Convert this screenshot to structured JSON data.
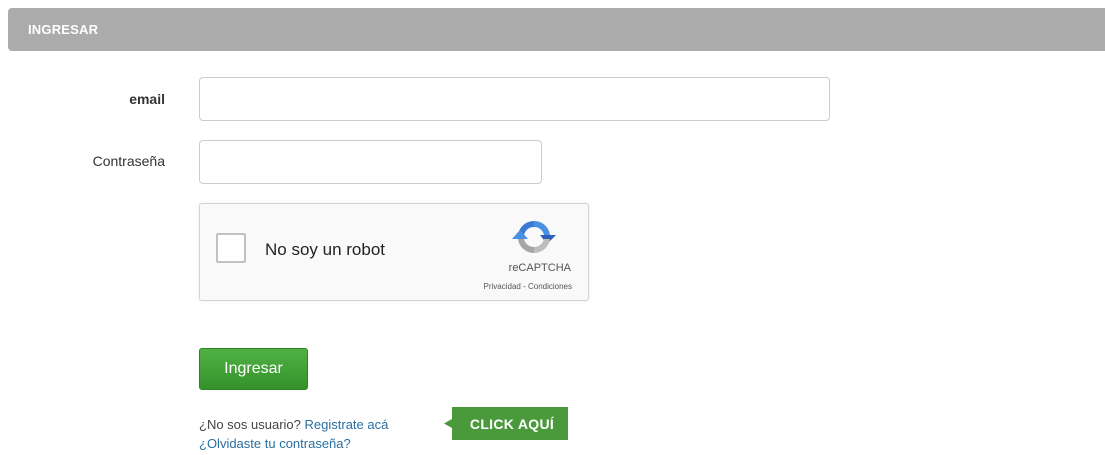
{
  "header": {
    "title": "INGRESAR"
  },
  "form": {
    "email_label": "email",
    "email_value": "",
    "password_label": "Contraseña",
    "password_value": "",
    "submit_label": "Ingresar"
  },
  "recaptcha": {
    "checkbox_label": "No soy un robot",
    "brand": "reCAPTCHA",
    "links": "Privacidad - Condiciones",
    "icon": "recaptcha-logo-icon"
  },
  "footer": {
    "not_user_text": "¿No sos usuario?",
    "register_link": "Registrate acá",
    "forgot_link": "¿Olvidaste tu contraseña?",
    "click_here": "CLICK AQUÍ"
  },
  "colors": {
    "header_bg": "#ababab",
    "button_green": "#3a9a2f",
    "link_blue": "#2a6fa0",
    "badge_green": "#4a9a3c"
  }
}
